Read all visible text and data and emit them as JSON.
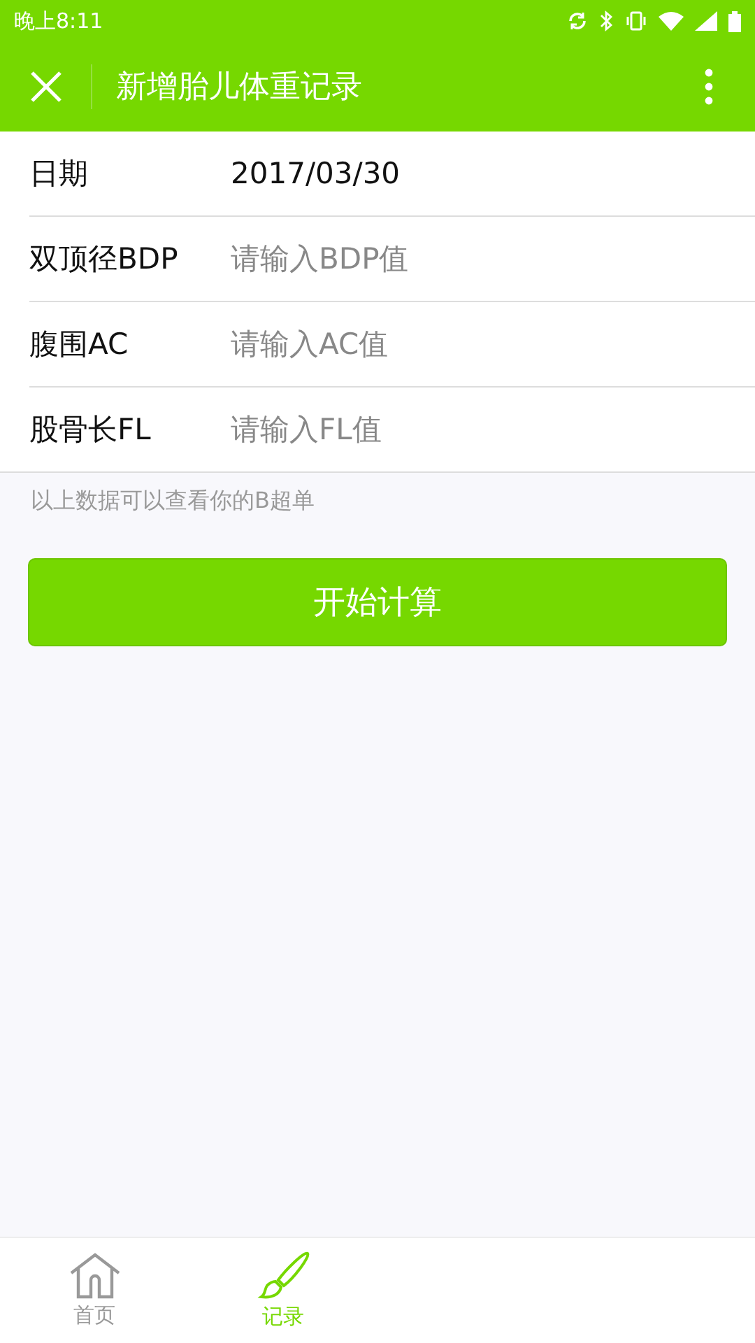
{
  "status_bar": {
    "time": "晚上8:11"
  },
  "title_bar": {
    "title": "新增胎儿体重记录"
  },
  "form": {
    "rows": [
      {
        "label": "日期",
        "value": "2017/03/30"
      },
      {
        "label": "双顶径BDP",
        "placeholder": "请输入BDP值"
      },
      {
        "label": "腹围AC",
        "placeholder": "请输入AC值"
      },
      {
        "label": "股骨长FL",
        "placeholder": "请输入FL值"
      }
    ],
    "hint": "以上数据可以查看你的B超单"
  },
  "button": "开始计算",
  "tab_bar": [
    {
      "label": "首页",
      "kind": "home",
      "selected": false
    },
    {
      "label": "记录",
      "kind": "brush",
      "selected": true
    }
  ]
}
